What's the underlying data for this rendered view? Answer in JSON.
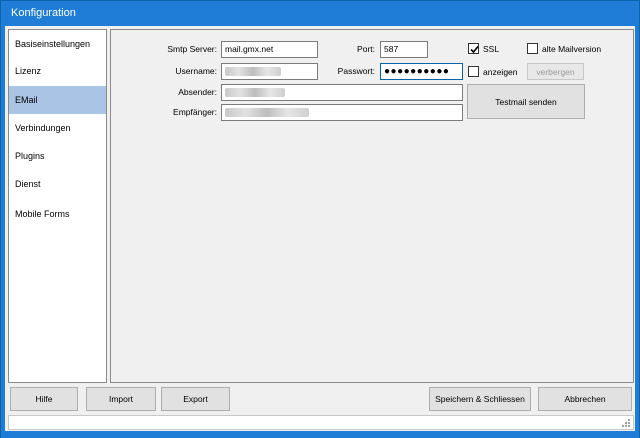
{
  "window": {
    "title": "Konfiguration"
  },
  "sidebar": {
    "items": [
      {
        "label": "Basiseinstellungen"
      },
      {
        "label": "Lizenz"
      },
      {
        "label": "EMail"
      },
      {
        "label": "Verbindungen"
      },
      {
        "label": "Plugins"
      },
      {
        "label": "Dienst"
      },
      {
        "label": "Mobile Forms"
      }
    ],
    "active": "EMail"
  },
  "email": {
    "smtp_label": "Smtp Server:",
    "smtp_value": "mail.gmx.net",
    "port_label": "Port:",
    "port_value": "587",
    "ssl_label": "SSL",
    "ssl_checked": true,
    "alte_label": "alte Mailversion",
    "alte_checked": false,
    "username_label": "Username:",
    "passwort_label": "Passwort:",
    "passwort_value": "●●●●●●●●●●",
    "anzeigen_label": "anzeigen",
    "anzeigen_checked": false,
    "verbergen_label": "verbergen",
    "absender_label": "Absender:",
    "empfaenger_label": "Empfänger:",
    "testmail_label": "Testmail senden"
  },
  "footer": {
    "hilfe": "Hilfe",
    "import": "Import",
    "export": "Export",
    "speichern": "Speichern & Schliessen",
    "abbrechen": "Abbrechen"
  },
  "colors": {
    "titlebar": "#1f7dd7",
    "active_item": "#a9c4e4"
  }
}
